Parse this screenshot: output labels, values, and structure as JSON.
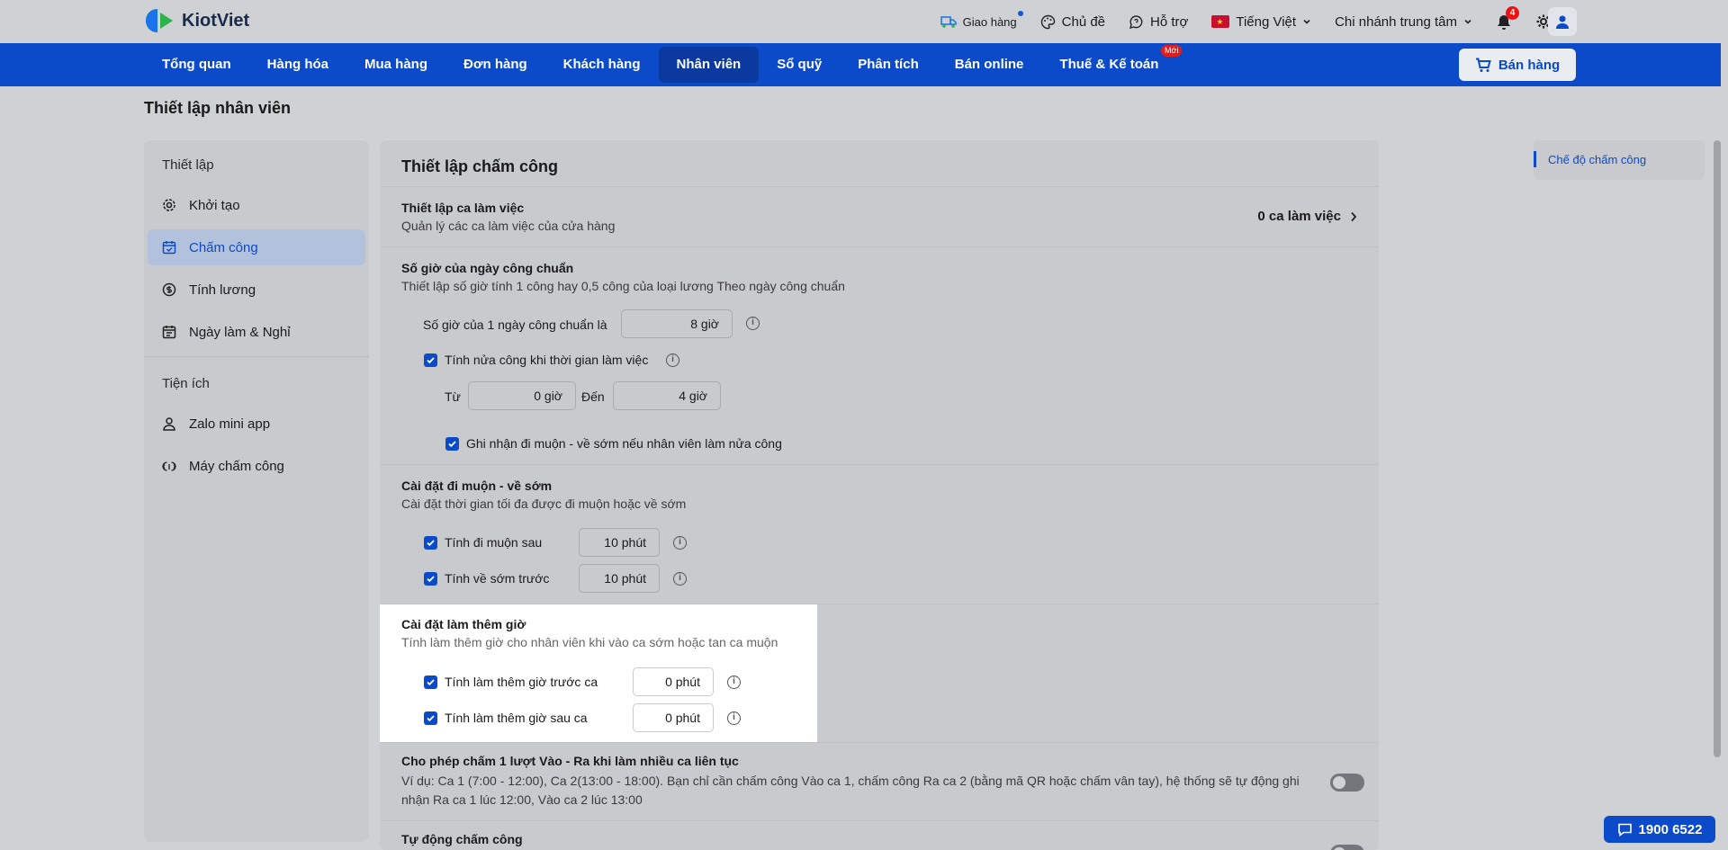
{
  "brand": {
    "name": "KiotViet"
  },
  "topbar": {
    "delivery": "Giao hàng",
    "theme": "Chủ đề",
    "support": "Hỗ trợ",
    "language": "Tiếng Việt",
    "branch": "Chi nhánh trung tâm",
    "notification_count": "4"
  },
  "nav": {
    "items": [
      "Tổng quan",
      "Hàng hóa",
      "Mua hàng",
      "Đơn hàng",
      "Khách hàng",
      "Nhân viên",
      "Sổ quỹ",
      "Phân tích",
      "Bán online",
      "Thuế & Kế toán"
    ],
    "active": "Nhân viên",
    "new_badge": "Mới",
    "sell_button": "Bán hàng"
  },
  "page": {
    "title": "Thiết lập nhân viên"
  },
  "sidebar": {
    "group1": "Thiết lập",
    "items1": [
      "Khởi tạo",
      "Chấm công",
      "Tính lương",
      "Ngày làm & Nghỉ"
    ],
    "group2": "Tiện ích",
    "items2": [
      "Zalo mini app",
      "Máy chấm công"
    ]
  },
  "main": {
    "title": "Thiết lập chấm công",
    "shift": {
      "title": "Thiết lập ca làm việc",
      "subtitle": "Quản lý các ca làm việc của cửa hàng",
      "count": "0 ca làm việc"
    },
    "standard_hours": {
      "title": "Số giờ của ngày công chuẩn",
      "subtitle": "Thiết lập số giờ tính 1 công hay 0,5 công của loại lương Theo ngày công chuẩn",
      "hours_label": "Số giờ của 1 ngày công chuẩn là",
      "hours_value": "8 giờ",
      "half_label": "Tính nửa công khi thời gian làm việc",
      "from_label": "Từ",
      "from_value": "0 giờ",
      "to_label": "Đến",
      "to_value": "4 giờ",
      "record_label": "Ghi nhận đi muộn - về sớm nếu nhân viên làm nửa công"
    },
    "late_early": {
      "title": "Cài đặt đi muộn - về sớm",
      "subtitle": "Cài đặt thời gian tối đa được đi muộn hoặc về sớm",
      "late_label": "Tính đi muộn sau",
      "late_value": "10 phút",
      "early_label": "Tính về sớm trước",
      "early_value": "10 phút"
    },
    "overtime": {
      "title": "Cài đặt làm thêm giờ",
      "subtitle": "Tính làm thêm giờ cho nhân viên khi vào ca sớm hoặc tan ca muộn",
      "before_label": "Tính làm thêm giờ trước ca",
      "before_value": "0 phút",
      "after_label": "Tính làm thêm giờ sau ca",
      "after_value": "0 phút"
    },
    "multi_shift": {
      "title": "Cho phép chấm 1 lượt Vào - Ra khi làm nhiều ca liên tục",
      "desc": "Ví dụ: Ca 1 (7:00 - 12:00), Ca 2(13:00 - 18:00). Bạn chỉ cần chấm công Vào ca 1, chấm công Ra ca 2 (bằng mã QR hoặc chấm vân tay), hệ thống sẽ tự động ghi nhận Ra ca 1 lúc 12:00, Vào ca 2 lúc 13:00"
    },
    "auto": {
      "title": "Tự động chấm công"
    }
  },
  "right_nav": {
    "link": "Chế độ chấm công"
  },
  "hotline": "1900 6522"
}
